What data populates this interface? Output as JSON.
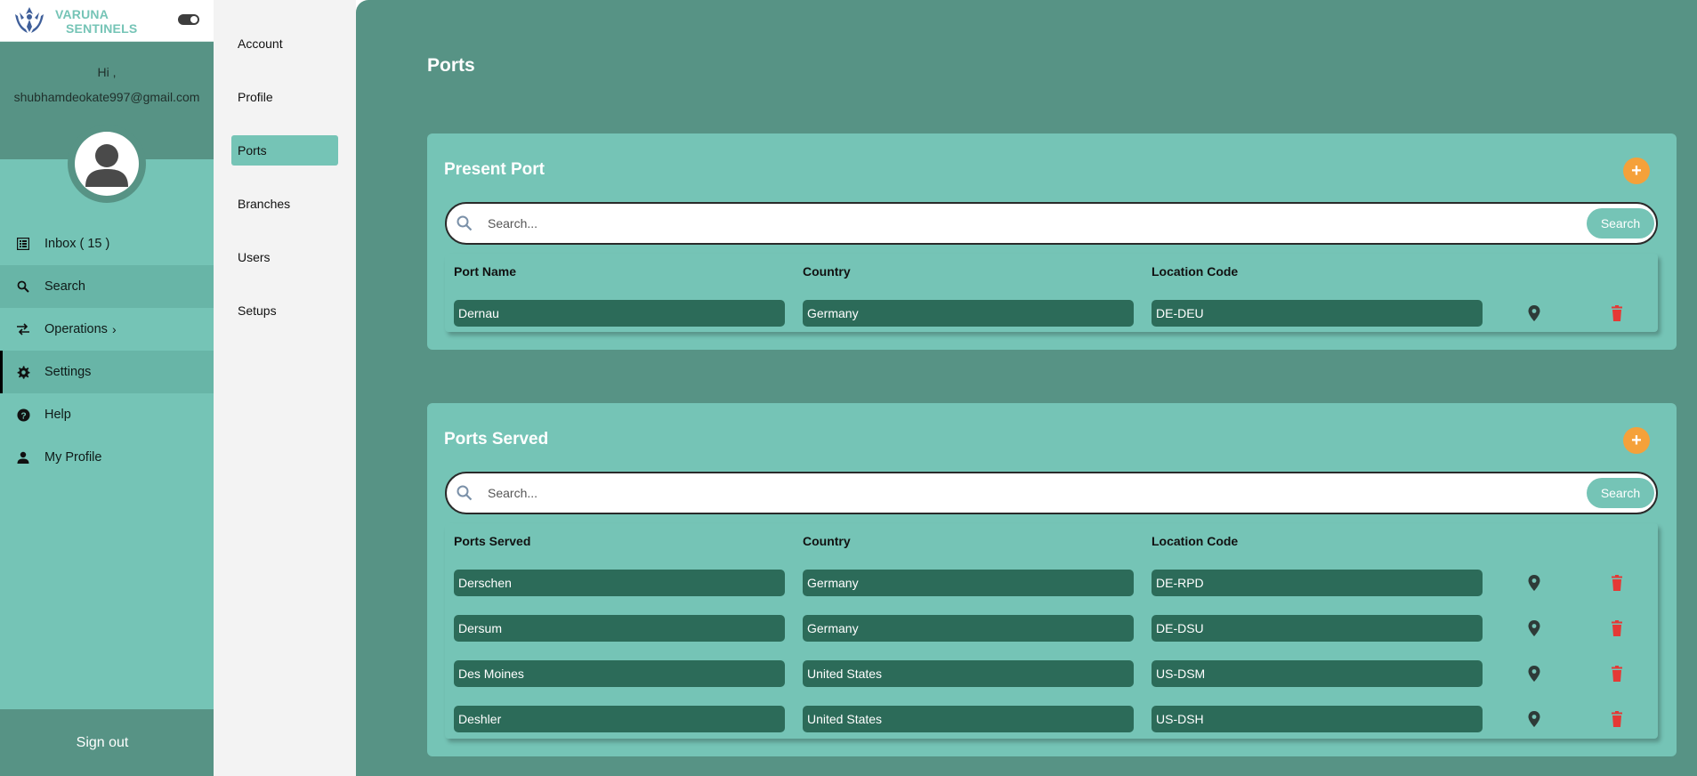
{
  "brand": {
    "line1": "VARUNA",
    "line2": "SENTINELS"
  },
  "user": {
    "greeting": "Hi ,",
    "email": "shubhamdeokate997@gmail.com"
  },
  "nav": {
    "inbox": "Inbox ( 15 )",
    "search": "Search",
    "operations": "Operations",
    "settings": "Settings",
    "help": "Help",
    "my_profile": "My Profile"
  },
  "signout": "Sign out",
  "subnav": {
    "account": "Account",
    "profile": "Profile",
    "ports": "Ports",
    "branches": "Branches",
    "users": "Users",
    "setups": "Setups"
  },
  "page_title": "Ports",
  "present_port": {
    "title": "Present Port",
    "add": "+",
    "search_placeholder": "Search...",
    "search_button": "Search",
    "headers": {
      "name": "Port Name",
      "country": "Country",
      "code": "Location Code"
    },
    "rows": [
      {
        "name": "Dernau",
        "country": "Germany",
        "code": "DE-DEU"
      }
    ]
  },
  "ports_served": {
    "title": "Ports Served",
    "add": "+",
    "search_placeholder": "Search...",
    "search_button": "Search",
    "headers": {
      "name": "Ports Served",
      "country": "Country",
      "code": "Location Code"
    },
    "rows": [
      {
        "name": "Derschen",
        "country": "Germany",
        "code": "DE-RPD"
      },
      {
        "name": "Dersum",
        "country": "Germany",
        "code": "DE-DSU"
      },
      {
        "name": "Des Moines",
        "country": "United States",
        "code": "US-DSM"
      },
      {
        "name": "Deshler",
        "country": "United States",
        "code": "US-DSH"
      }
    ]
  },
  "colors": {
    "sidebar": "#75c4b6",
    "sidebar_dark": "#579385",
    "cell": "#2c6b59",
    "accent_orange": "#f5a13a",
    "delete_red": "#e53935"
  }
}
